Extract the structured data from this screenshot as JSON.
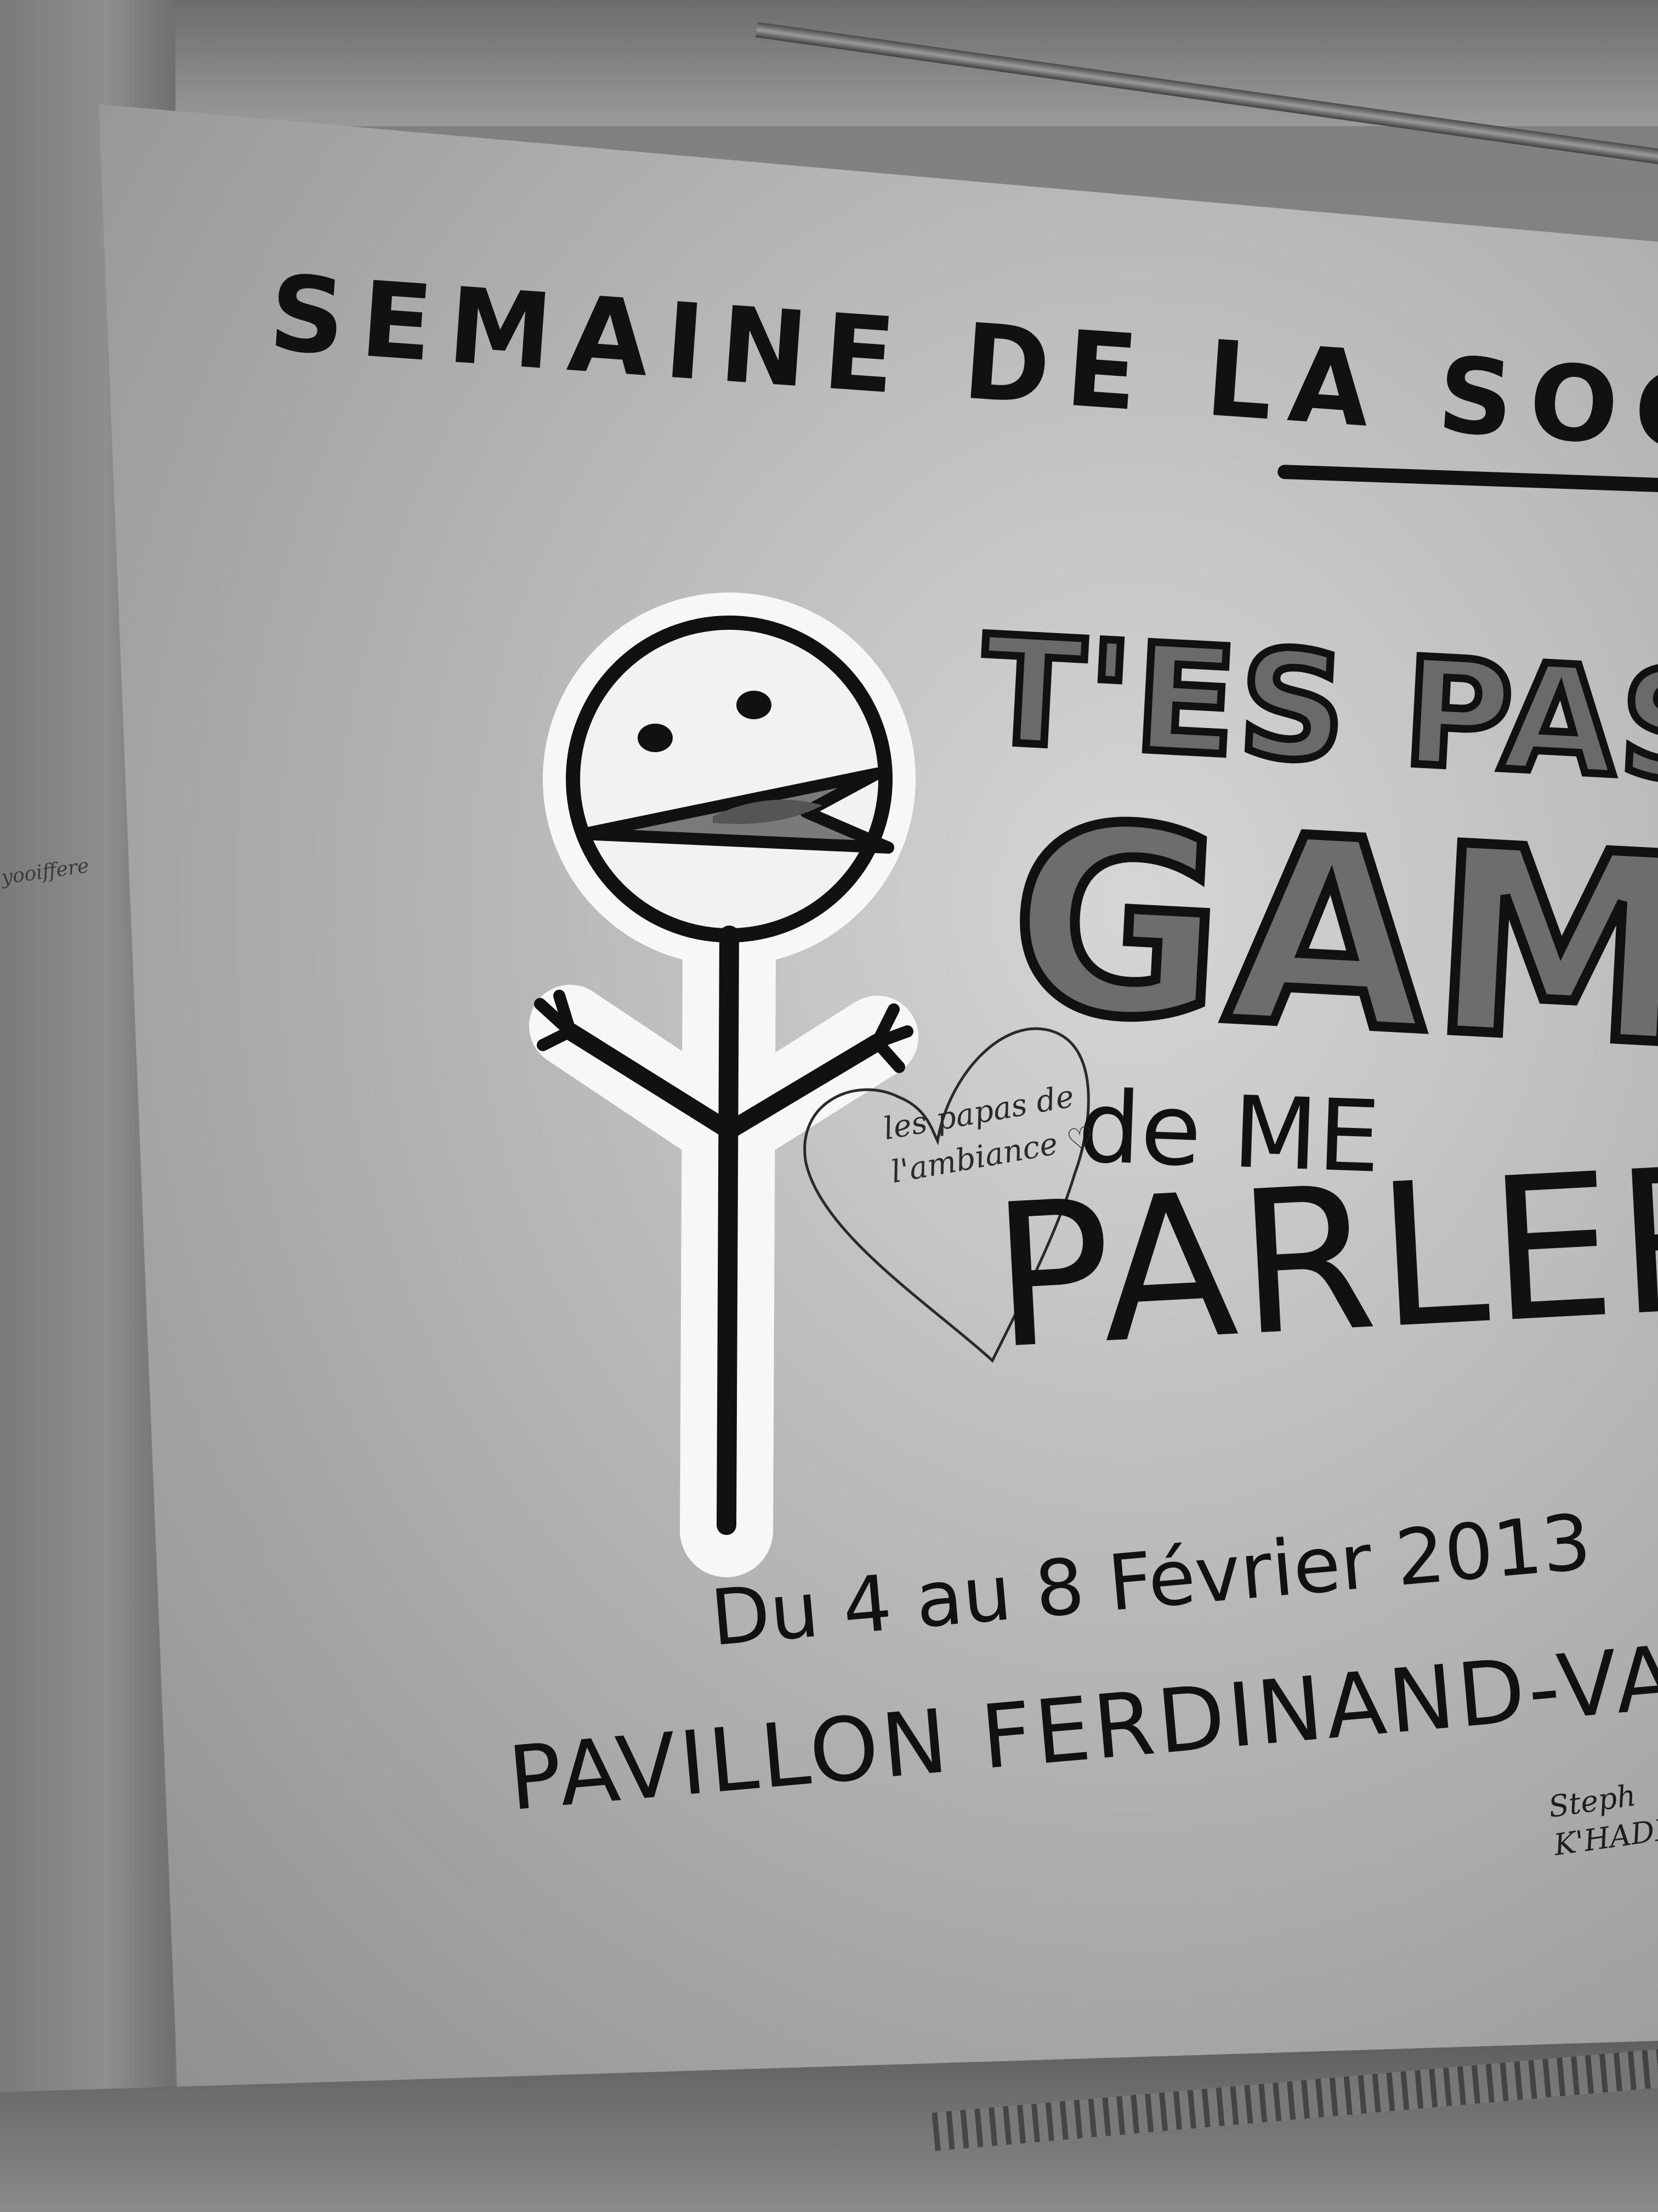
{
  "image": {
    "style": "black-and-white photo",
    "colors": {
      "paint_black": "#111111",
      "paint_gray_fill": "#6a6a6a",
      "figure_outline_white": "#f7f7f7",
      "wall_light": "#d6d6d6"
    }
  },
  "mural": {
    "headline": "SEMAINE DE LA SOCIABIL",
    "slogan_line1": "T'ES PAS",
    "slogan_line2": "GAME",
    "slogan_line3": "de ME",
    "slogan_line4": "PARLER",
    "dates": "Du 4 au 8 Février 2013",
    "venue": "PAVILLON FERDINAND-VANDRY",
    "figure": "stick figure with open-mouth smiling face and raised arms"
  },
  "graffiti": {
    "heart_note_line1": "les papas de",
    "heart_note_line2": "l'ambiance ♡",
    "signature_line1": "Steph",
    "signature_line2": "K'HADI",
    "left_scribble": "yooiffere"
  }
}
